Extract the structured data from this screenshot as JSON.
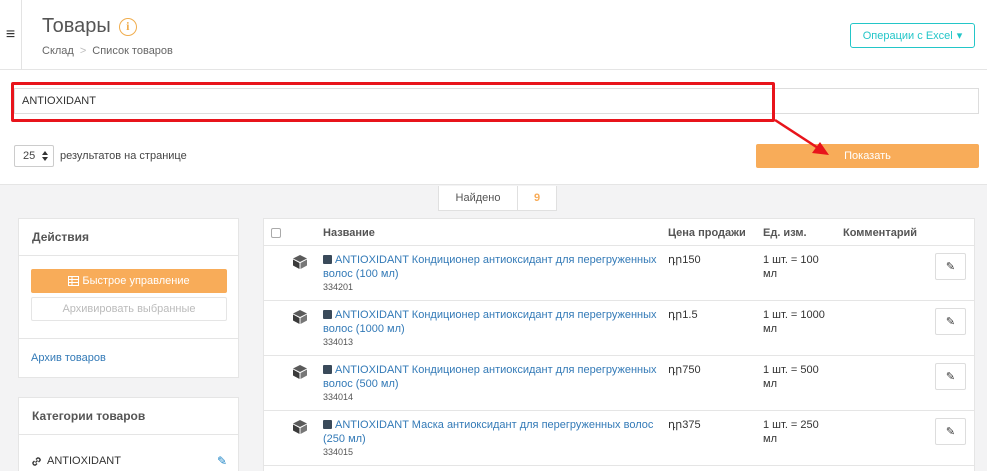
{
  "header": {
    "menu_icon": "hamburger-icon",
    "title": "Товары",
    "info_icon": "info-icon",
    "info_glyph": "i",
    "breadcrumb": [
      "Склад",
      "Список товаров"
    ],
    "breadcrumb_sep": ">",
    "excel_button": "Операции с Excel",
    "excel_caret": "▾"
  },
  "search": {
    "value": "ANTIOXIDANT",
    "per_page_value": "25",
    "per_page_label": "результатов на странице",
    "show_button": "Показать"
  },
  "found": {
    "label": "Найдено",
    "count": "9"
  },
  "actions": {
    "title": "Действия",
    "quick_button": "Быстрое управление",
    "archive_selected_button": "Архивировать выбранные",
    "archive_link": "Архив товаров"
  },
  "categories": {
    "title": "Категории товаров",
    "items": [
      {
        "label": "ANTIOXIDANT"
      }
    ]
  },
  "table": {
    "headers": {
      "name": "Название",
      "price": "Цена продажи",
      "unit": "Ед. изм.",
      "comment": "Комментарий"
    },
    "rows": [
      {
        "name": "ANTIOXIDANT Кондиционер антиоксидант для перегруженных волос (100 мл)",
        "code": "334201",
        "price": "դր150",
        "unit": "1 шт. = 100 мл"
      },
      {
        "name": "ANTIOXIDANT Кондиционер антиоксидант для перегруженных волос (1000 мл)",
        "code": "334013",
        "price": "դր1.5",
        "unit": "1 шт. = 1000 мл"
      },
      {
        "name": "ANTIOXIDANT Кондиционер антиоксидант для перегруженных волос (500 мл)",
        "code": "334014",
        "price": "դր750",
        "unit": "1 шт. = 500 мл"
      },
      {
        "name": "ANTIOXIDANT Маска антиоксидант для перегруженных волос (250 мл)",
        "code": "334015",
        "price": "դր375",
        "unit": "1 шт. = 250 мл"
      }
    ]
  },
  "colors": {
    "accent_orange": "#f8ac59",
    "accent_teal": "#23c6c8",
    "link_blue": "#337ab7",
    "annotation_red": "#e8141b"
  }
}
